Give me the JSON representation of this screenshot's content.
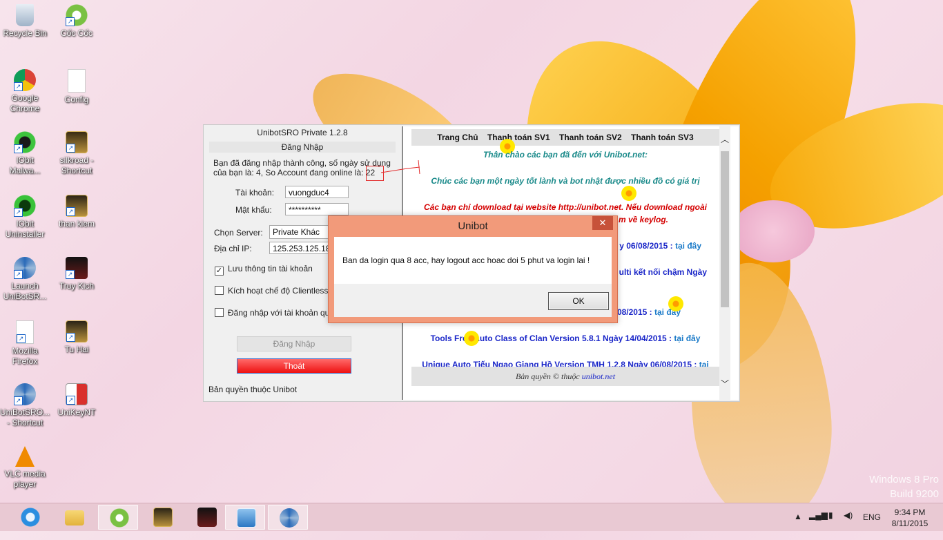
{
  "desktop": {
    "icons": [
      {
        "label": "Recycle Bin",
        "icon": "recycle-bin-icon"
      },
      {
        "label": "Cốc Cốc",
        "icon": "coccoc-icon"
      },
      {
        "label": "Google Chrome",
        "icon": "chrome-icon"
      },
      {
        "label": "Config",
        "icon": "file-icon"
      },
      {
        "label": "IObit Malwa...",
        "icon": "iobit-malware-icon"
      },
      {
        "label": "silkroad - Shortcut",
        "icon": "silkroad-icon"
      },
      {
        "label": "IObit Uninstaller",
        "icon": "iobit-uninstaller-icon"
      },
      {
        "label": "than kiem",
        "icon": "game-icon"
      },
      {
        "label": "Launch UniBotSR...",
        "icon": "unibot-icon"
      },
      {
        "label": "Truy Kich",
        "icon": "truykich-icon"
      },
      {
        "label": "Mozilla Firefox",
        "icon": "firefox-icon"
      },
      {
        "label": "Tu Hai",
        "icon": "game-icon"
      },
      {
        "label": "UniBotSRO... - Shortcut",
        "icon": "unibot-icon"
      },
      {
        "label": "UniKeyNT",
        "icon": "unikey-icon"
      },
      {
        "label": "VLC media player",
        "icon": "vlc-icon"
      }
    ],
    "watermark": {
      "line1": "Windows 8 Pro",
      "line2": "Build 9200"
    }
  },
  "app": {
    "title": "UnibotSRO Private 1.2.8",
    "login_header": "Đăng Nhập",
    "message": "Bạn đã đăng nhập thành công, số ngày sử dụng của bạn là: 4, So Account đang online là: 22",
    "account_label": "Tài khoản:",
    "account_value": "vuongduc4",
    "password_label": "Mật khẩu:",
    "password_value": "**********",
    "server_label": "Chọn Server:",
    "server_value": "Private Khác",
    "ip_label": "Địa chỉ IP:",
    "ip_value": "125.253.125.18",
    "save_info_label": "Lưu thông tin tài khoản",
    "save_info_checked": "✓",
    "clientless_label": "Kích hoạt chế độ Clientless",
    "other_account_label": "Đăng nhập với tài khoản qu",
    "login_button": "Đăng Nhập",
    "exit_button": "Thoát",
    "copyright": "Bản quyền thuộc Unibot"
  },
  "web": {
    "nav": [
      "Trang Chủ",
      "Thanh toán SV1",
      "Thanh toán SV2",
      "Thanh toán SV3"
    ],
    "greeting": "Thân chào các bạn đã đến với Unibot.net:",
    "wish": "Chúc các bạn một ngày tốt lành và bot nhật được nhiều đồ có giá trị",
    "warning1": "Các bạn chỉ download tại website http://unibot.net. Nếu download ngoài",
    "warning2": "m về keylog.",
    "item1_text": "y 06/08/2015 : ",
    "item1_link": "tại đây",
    "item2_text": "ulti kết nối chậm Ngày",
    "item3_text": "08/2015 : ",
    "item3_link": "tại đây",
    "item4_text": "Tools Free Auto Class of Clan Version 5.8.1 Ngày 14/04/2015 : ",
    "item4_link": "tại đây",
    "item5_text": "Unique Auto Tiếu Ngạo Giang Hồ Version TMH 1.2.8 Ngày 06/08/2015 : ",
    "item5_link": "tại",
    "footer_text": "Bản quyền © thuộc ",
    "footer_link": "unibot.net"
  },
  "dialog": {
    "title": "Unibot",
    "close": "✕",
    "message": "Ban da login qua 8 acc, hay logout acc hoac doi 5 phut va login lai !",
    "ok": "OK"
  },
  "taskbar": {
    "language": "ENG",
    "time": "9:34 PM",
    "date": "8/11/2015"
  },
  "colors": {
    "dialog_frame": "#f29a7a",
    "exit_button": "#ee1111",
    "link_blue": "#1a26c8",
    "teal_text": "#1a8a8a",
    "red_text": "#d40000"
  }
}
